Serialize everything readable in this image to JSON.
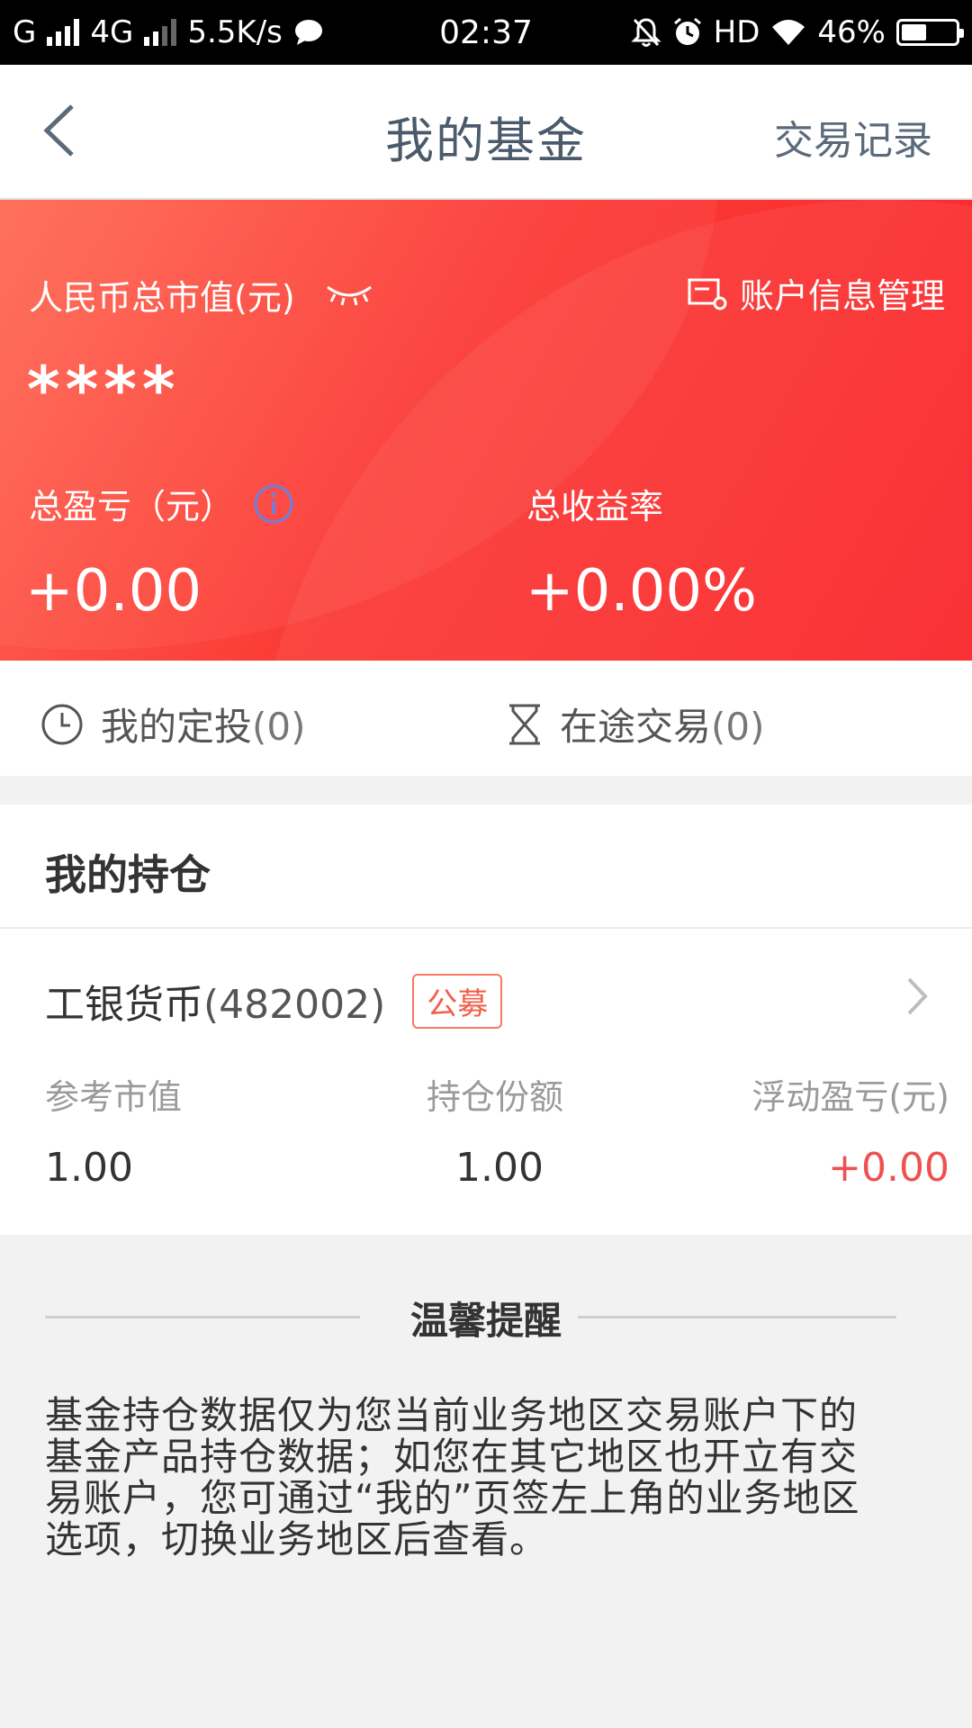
{
  "status_bar": {
    "carrier": "G",
    "network": "4G",
    "speed": "5.5K/s",
    "time": "02:37",
    "hd": "HD",
    "battery": "46%"
  },
  "nav": {
    "title": "我的基金",
    "right_link": "交易记录"
  },
  "summary": {
    "total_value_label": "人民币总市值(元)",
    "account_manage_label": "账户信息管理",
    "masked_value": "****",
    "total_pl_label": "总盈亏（元）",
    "total_return_label": "总收益率",
    "total_pl_value": "+0.00",
    "total_return_value": "+0.00%"
  },
  "quick_links": {
    "auto_invest_label": "我的定投",
    "auto_invest_count": "(0)",
    "pending_label": "在途交易",
    "pending_count": "(0)"
  },
  "holdings": {
    "title": "我的持仓",
    "fund": {
      "name": "工银货币",
      "code": "(482002)",
      "badge": "公募",
      "ref_value_label": "参考市值",
      "shares_label": "持仓份额",
      "float_pl_label": "浮动盈亏(元)",
      "ref_value": "1.00",
      "shares": "1.00",
      "float_pl": "+0.00"
    }
  },
  "reminder": {
    "title": "温馨提醒",
    "text": "基金持仓数据仅为您当前业务地区交易账户下的基金产品持仓数据；如您在其它地区也开立有交易账户，您可通过“我的”页签左上角的业务地区选项，切换业务地区后查看。"
  },
  "colors": {
    "accent_red": "#f9252a",
    "profit_red": "#f05050",
    "badge_orange": "#f0604a"
  }
}
